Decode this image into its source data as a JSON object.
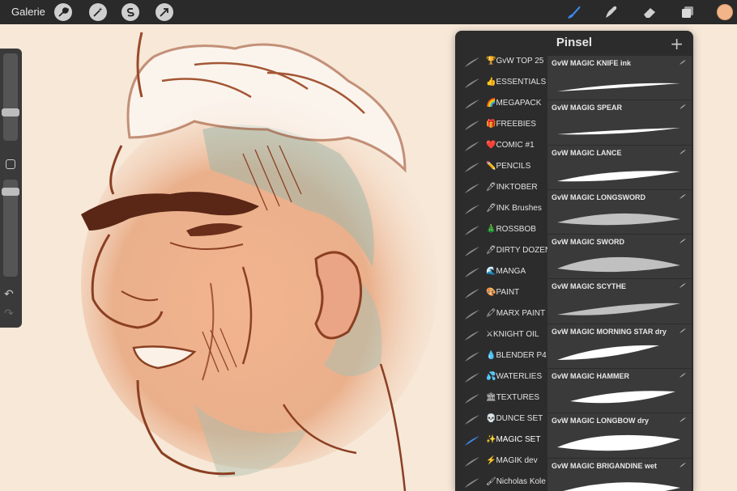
{
  "topbar": {
    "gallery_label": "Galerie",
    "tools_left": [
      "wrench-icon",
      "magic-wand-icon",
      "selection-icon",
      "transform-icon"
    ],
    "tools_right": [
      "brush-icon",
      "smudge-icon",
      "eraser-icon",
      "layers-icon"
    ],
    "color": "#f2b58a"
  },
  "panel": {
    "title": "Pinsel",
    "add_label": "+",
    "sets": [
      {
        "emoji": "🏆",
        "label": "GvW TOP 25"
      },
      {
        "emoji": "👍",
        "label": "ESSENTIALS"
      },
      {
        "emoji": "🌈",
        "label": "MEGAPACK"
      },
      {
        "emoji": "🎁",
        "label": "FREEBIES"
      },
      {
        "emoji": "❤️",
        "label": "COMIC #1"
      },
      {
        "emoji": "✏️",
        "label": "PENCILS"
      },
      {
        "emoji": "🖊",
        "label": "INKTOBER"
      },
      {
        "emoji": "🖋",
        "label": "INK Brushes"
      },
      {
        "emoji": "🎄",
        "label": "ROSSBOB"
      },
      {
        "emoji": "🖊",
        "label": "DIRTY DOZEN"
      },
      {
        "emoji": "🌊",
        "label": "MANGA"
      },
      {
        "emoji": "🎨",
        "label": "PAINT"
      },
      {
        "emoji": "🖍",
        "label": "MARX PAINT"
      },
      {
        "emoji": "⚔",
        "label": "KNIGHT OIL"
      },
      {
        "emoji": "💧",
        "label": "BLENDER P4"
      },
      {
        "emoji": "💦",
        "label": "WATERLIES"
      },
      {
        "emoji": "🏛",
        "label": "TEXTURES"
      },
      {
        "emoji": "💀",
        "label": "DUNCE SET"
      },
      {
        "emoji": "✨",
        "label": "MAGIC SET",
        "active": true
      },
      {
        "emoji": "⚡",
        "label": "MAGIK dev"
      },
      {
        "emoji": "🖌",
        "label": "Nicholas Kole"
      }
    ],
    "brushes": [
      {
        "name": "GvW MAGIC KNIFE ink"
      },
      {
        "name": "GvW MAGIG SPEAR"
      },
      {
        "name": "GvW MAGIC LANCE"
      },
      {
        "name": "GvW MAGIC LONGSWORD"
      },
      {
        "name": "GvW MAGIC SWORD"
      },
      {
        "name": "GvW MAGIC SCYTHE"
      },
      {
        "name": "GvW MAGIC MORNING STAR dry"
      },
      {
        "name": "GvW MAGIC HAMMER"
      },
      {
        "name": "GvW MAGIC LONGBOW dry"
      },
      {
        "name": "GvW MAGIC BRIGANDINE wet"
      }
    ]
  }
}
